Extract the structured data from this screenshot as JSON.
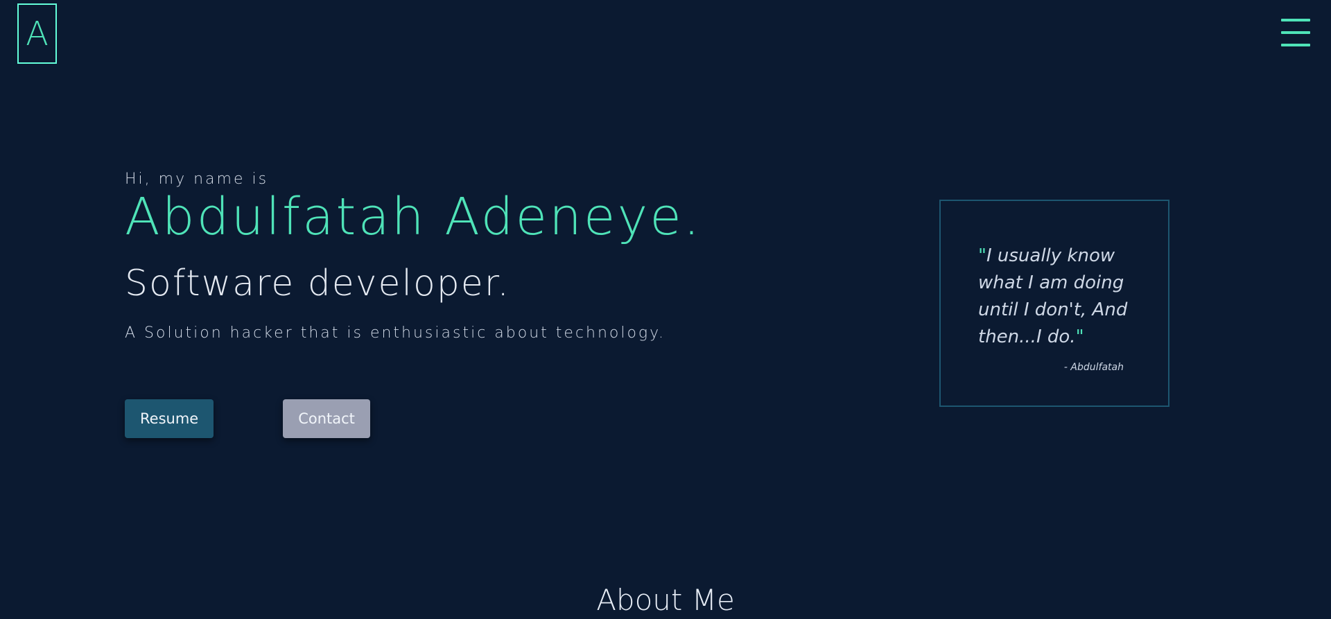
{
  "header": {
    "logo_text": "A",
    "menu_icon": "hamburger-menu-icon"
  },
  "hero": {
    "greeting": "Hi, my name is",
    "name": "Abdulfatah Adeneye.",
    "role": "Software developer.",
    "tagline": "A Solution hacker that is enthusiastic about technology."
  },
  "buttons": {
    "resume_label": "Resume",
    "contact_label": "Contact"
  },
  "quote": {
    "open_mark": "\"",
    "text": "I usually know what I am doing until I don't, And then...I do.",
    "close_mark": "\"",
    "author": "- Abdulfatah"
  },
  "about": {
    "title": "About Me"
  },
  "colors": {
    "background": "#0b1a31",
    "accent": "#4fe3b8",
    "resume_button": "#1d5670",
    "contact_button": "#9a9fb2",
    "card_border": "#1d5670"
  }
}
